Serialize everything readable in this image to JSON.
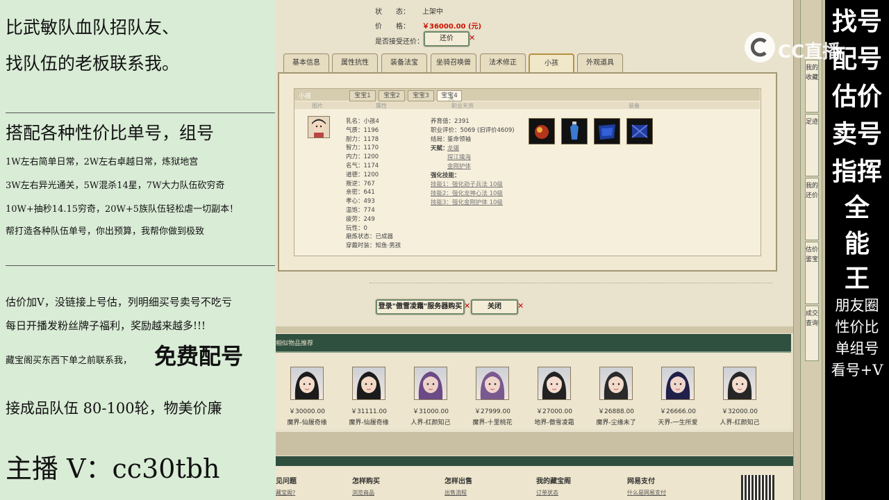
{
  "promo_left": {
    "line1": "比武敏队血队招队友、",
    "line2": "找队伍的老板联系我。",
    "line3": "搭配各种性价比单号，组号",
    "line4": "1W左右简单日常，2W左右卓越日常，炼狱地宫",
    "line5": "3W左右异光通关，5W混杀14星，7W大力队伍砍穷奇",
    "line6": "10W+抽秒14.15穷奇，20W+5族队伍轻松虐一切副本！",
    "line7": "帮打造各种队伍单号，你出预算，我帮你做到极致",
    "line8": "估价加V，没链接上号估，列明细买号卖号不吃亏",
    "line9": "每日开播发粉丝牌子福利，奖励越来越多!!!",
    "line10a": "藏宝阁买东西下单之前联系我，",
    "line10b": "免费配号",
    "line11": "接成品队伍 80-100轮，物美价廉",
    "line12": "主播 V：cc30tbh"
  },
  "promo_right": {
    "big": [
      "找号",
      "配号",
      "估价",
      "卖号",
      "指挥",
      "全",
      "能",
      "王"
    ],
    "small": [
      "朋友圈",
      "性价比",
      "单组号",
      "看号+V"
    ],
    "logo_text": "CC直播"
  },
  "status": {
    "status_label": "状　　态：",
    "status_value": "上架中",
    "price_label": "价　　格：",
    "price_value": "￥36000.00 (元)",
    "bargain_label": "是否接受还价：",
    "bargain_button": "还价"
  },
  "tabs": [
    "基本信息",
    "属性抗性",
    "装备法宝",
    "坐骑召唤兽",
    "法术修正",
    "小孩",
    "外观道具"
  ],
  "child_panel": {
    "header": "小孩",
    "subtabs": [
      "宝宝1",
      "宝宝2",
      "宝宝3",
      "宝宝4"
    ],
    "col_image": "图片",
    "col_attr": "属性",
    "col_job": "职业天资",
    "col_equip": "装备",
    "attrs": [
      "乳名：小孩4",
      "气质：1196",
      "耐力：1178",
      "智力：1170",
      "内力：1200",
      "名气：1174",
      "道德：1200",
      "叛逆：767",
      "亲密：641",
      "孝心：493",
      "温饱：774",
      "疲劳：249",
      "玩性：0",
      "磨炼状态：已成器",
      "穿戴时装：知鱼·男孩"
    ],
    "nurture_value": "养育值：2391",
    "job_score": "职业评价：5069 (旧评价4609)",
    "ending_label": "结局：",
    "ending_value": "鉴命领袖",
    "talent_label": "天赋：",
    "talents": [
      "龙骧",
      "探江擒海",
      "金刚护体"
    ],
    "skill_label": "强化技能：",
    "skills": [
      "技能1：强化劲子兵法 10级",
      "技能2：强化龙神心法 10级",
      "技能3：强化金刚护体 10级"
    ]
  },
  "buttons": {
    "login_buy": "登录\"傲雪凌霜\"服务器购买",
    "close": "关闭"
  },
  "similar": {
    "header": "相似物品推荐",
    "items": [
      {
        "price": "￥30000.00",
        "name": "魔界-仙履奇缘"
      },
      {
        "price": "￥31111.00",
        "name": "魔界-仙履奇缘"
      },
      {
        "price": "￥31000.00",
        "name": "人界-红颜知己"
      },
      {
        "price": "￥27999.00",
        "name": "魔界-十里桃花"
      },
      {
        "price": "￥27000.00",
        "name": "地界-傲雪凌霜"
      },
      {
        "price": "￥26888.00",
        "name": "魔界-尘缘未了"
      },
      {
        "price": "￥26666.00",
        "name": "天界-一生所爱"
      },
      {
        "price": "￥32000.00",
        "name": "人界-红颜知己"
      }
    ]
  },
  "side_menu": [
    "我的收藏",
    "足迹",
    "我的还价",
    "估价鉴宝",
    "成交查询"
  ],
  "footer": {
    "cols": [
      "见问题",
      "怎样购买",
      "怎样出售",
      "我的藏宝阁",
      "网易支付"
    ],
    "links": [
      "藏宝阁?",
      "浏览商品",
      "出售流程",
      "订单状态",
      "什么是网易支付"
    ]
  },
  "colors": {
    "price_red": "#cc1100",
    "panel_bg": "#f1e9d2",
    "header_green": "#2f4f3f"
  }
}
